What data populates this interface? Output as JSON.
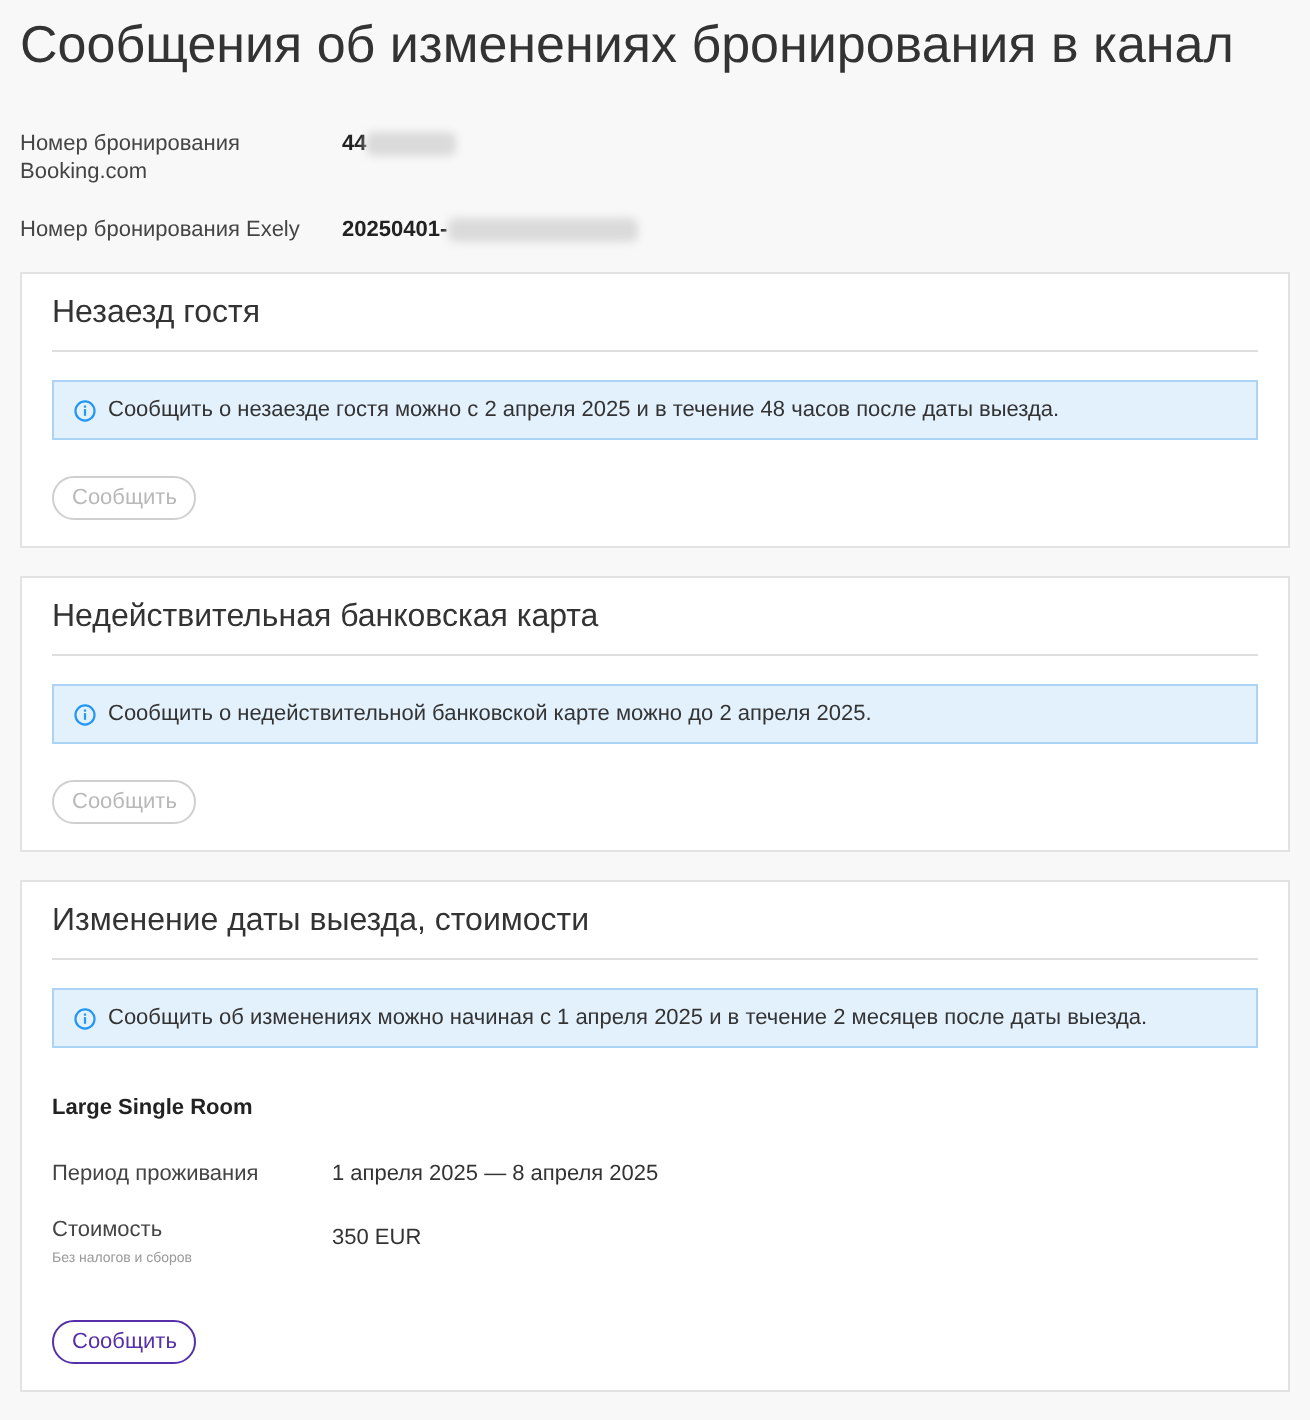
{
  "page": {
    "title": "Сообщения об изменениях бронирования в канал"
  },
  "booking_fields": [
    {
      "label": "Номер бронирования Booking.com",
      "value": "44",
      "redacted": true
    },
    {
      "label": "Номер бронирования Exely",
      "value": "20250401-",
      "redacted": true
    }
  ],
  "sections": [
    {
      "title": "Незаезд гостя",
      "notice": "Сообщить о незаезде гостя можно с 2 апреля 2025 и в течение 48 часов после даты выезда.",
      "button": {
        "label": "Сообщить",
        "disabled": true
      }
    },
    {
      "title": "Недействительная банковская карта",
      "notice": "Сообщить о недействительной банковской карте можно до 2 апреля 2025.",
      "button": {
        "label": "Сообщить",
        "disabled": true
      }
    },
    {
      "title": "Изменение даты выезда, стоимости",
      "notice": "Сообщить об изменениях можно начиная с 1 апреля 2025 и в течение 2 месяцев после даты выезда.",
      "room": "Large Single Room",
      "details": [
        {
          "label": "Период проживания",
          "value": "1 апреля 2025 — 8 апреля 2025"
        },
        {
          "label": "Стоимость",
          "note": "Без налогов и сборов",
          "value": "350 EUR"
        }
      ],
      "button": {
        "label": "Сообщить",
        "disabled": false
      }
    }
  ]
}
